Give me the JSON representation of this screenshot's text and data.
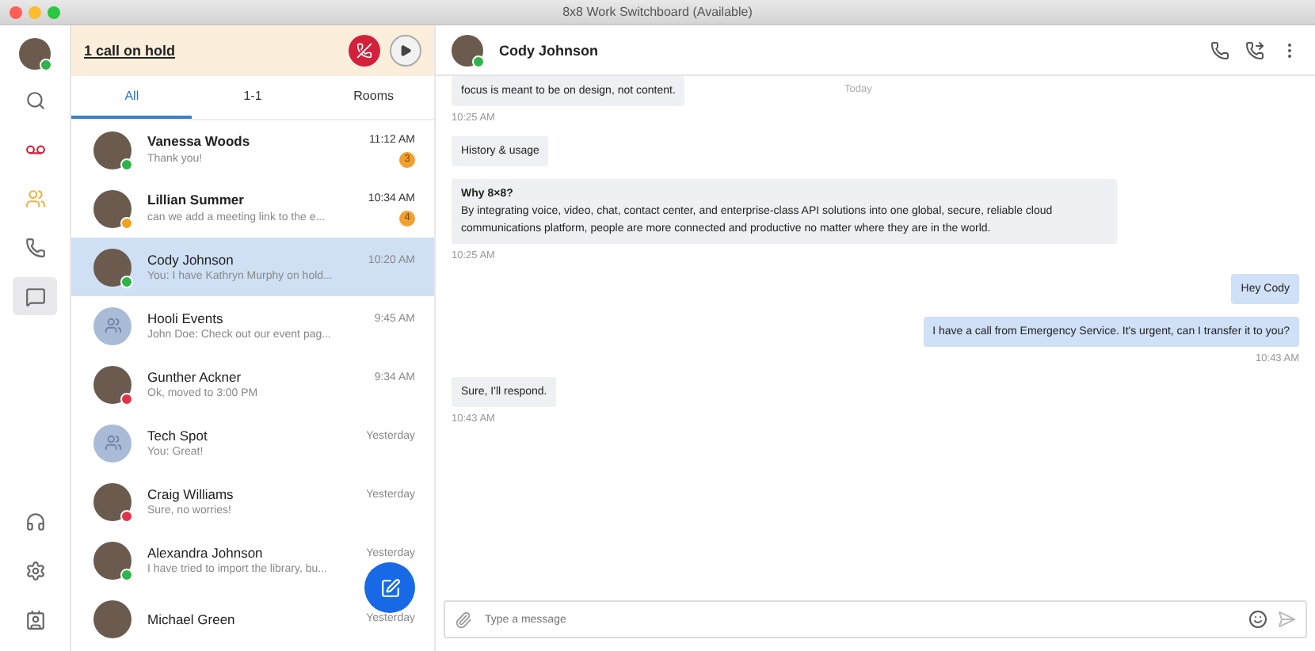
{
  "window": {
    "title": "8x8 Work Switchboard (Available)"
  },
  "rail": {
    "items": [
      {
        "kind": "search",
        "selected": false
      },
      {
        "kind": "voicemail",
        "selected": false
      },
      {
        "kind": "contacts",
        "selected": false
      },
      {
        "kind": "phone",
        "selected": false
      },
      {
        "kind": "chat",
        "selected": true
      }
    ],
    "bottom": [
      {
        "kind": "headset"
      },
      {
        "kind": "settings"
      },
      {
        "kind": "profile"
      }
    ]
  },
  "call_bar": {
    "label": "1 call on hold"
  },
  "tabs": [
    {
      "label": "All",
      "selected": true
    },
    {
      "label": "1-1",
      "selected": false
    },
    {
      "label": "Rooms",
      "selected": false
    }
  ],
  "conversations": [
    {
      "kind": "person",
      "name": "Vanessa Woods",
      "preview": "Thank you!",
      "time": "11:12 AM",
      "unread": "3",
      "color": "#2fb34a",
      "selected": false
    },
    {
      "kind": "person",
      "name": "Lillian Summer",
      "preview": "can we add a meeting link to the e...",
      "time": "10:34 AM",
      "unread": "4",
      "color": "#f0a020",
      "selected": false
    },
    {
      "kind": "person",
      "name": "Cody Johnson",
      "preview": "You: I have Kathryn Murphy on hold...",
      "time": "10:20 AM",
      "color": "#2fb34a",
      "selected": true
    },
    {
      "kind": "group",
      "name": "Hooli Events",
      "preview": "John Doe: Check out our event pag...",
      "time": "9:45 AM",
      "selected": false
    },
    {
      "kind": "person",
      "name": "Gunther Ackner",
      "preview": "Ok, moved to 3:00 PM",
      "time": "9:34 AM",
      "color": "#e0344a",
      "selected": false
    },
    {
      "kind": "group",
      "name": "Tech Spot",
      "preview": "You: Great!",
      "time": "Yesterday",
      "selected": false
    },
    {
      "kind": "person",
      "name": "Craig Williams",
      "preview": "Sure, no worries!",
      "time": "Yesterday",
      "color": "#e0344a",
      "selected": false
    },
    {
      "kind": "person",
      "name": "Alexandra Johnson",
      "preview": "I have tried to import the library, bu...",
      "time": "Yesterday",
      "color": "#2fb34a",
      "selected": false
    },
    {
      "kind": "person",
      "name": "Michael Green",
      "time": "Yesterday",
      "selected": false
    }
  ],
  "chat": {
    "name": "Cody Johnson",
    "date_chip": "Today",
    "messages": [
      {
        "kind": "in",
        "text": "focus is meant to be on design, not content.",
        "time": "10:25 AM"
      },
      {
        "kind": "in",
        "text": "History & usage"
      },
      {
        "kind": "in",
        "title": "Why 8×8?",
        "text": "By integrating voice, video, chat, contact center, and enterprise-class API solutions into one global, secure, reliable cloud communications platform, people are more connected and productive no matter where they are in the world.",
        "time": "10:25 AM"
      },
      {
        "kind": "out",
        "text": "Hey Cody"
      },
      {
        "kind": "out",
        "text": "I have a call from Emergency Service. It's urgent, can I transfer it to you?",
        "time": "10:43 AM"
      },
      {
        "kind": "in",
        "text": "Sure, I'll respond.",
        "time": "10:43 AM"
      }
    ],
    "composer": {
      "placeholder": "Type a message"
    }
  }
}
